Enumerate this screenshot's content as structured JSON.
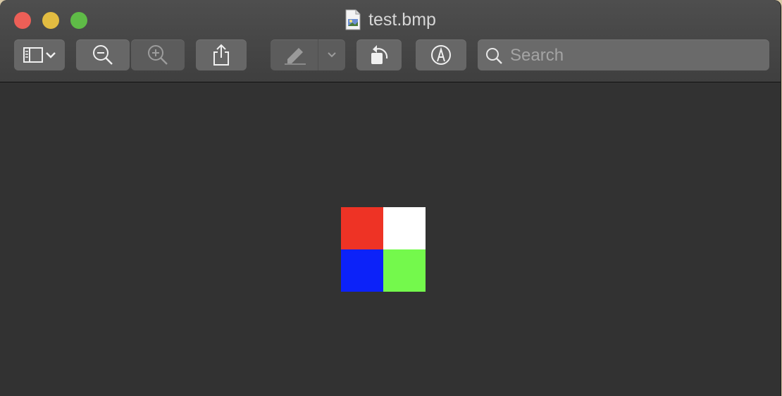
{
  "window": {
    "title": "test.bmp",
    "file_icon": "bmp-document-icon"
  },
  "toolbar": {
    "buttons": [
      {
        "name": "sidebar-toggle",
        "icon": "sidebar-icon",
        "menu_icon": "chevron-down-icon"
      },
      {
        "name": "zoom-out",
        "icon": "zoom-out-icon"
      },
      {
        "name": "zoom-in",
        "icon": "zoom-in-icon",
        "disabled": true
      },
      {
        "name": "share",
        "icon": "share-icon"
      },
      {
        "name": "highlight",
        "icon": "highlighter-icon",
        "menu_icon": "chevron-down-icon",
        "disabled": true
      },
      {
        "name": "rotate-left",
        "icon": "rotate-left-icon"
      },
      {
        "name": "markup",
        "icon": "markup-pen-icon"
      }
    ],
    "search": {
      "placeholder": "Search",
      "value": "",
      "icon": "search-icon"
    }
  },
  "image": {
    "pixels": [
      {
        "color": "#ee3325"
      },
      {
        "color": "#ffffff"
      },
      {
        "color": "#0c22f9"
      },
      {
        "color": "#74f94c"
      }
    ]
  },
  "colors": {
    "close": "#ec5f57",
    "minimize": "#e2bc41",
    "maximize": "#5fbb47",
    "content_bg": "#323232"
  }
}
